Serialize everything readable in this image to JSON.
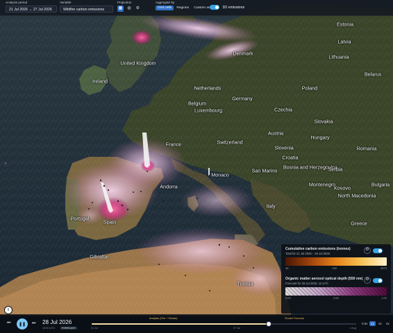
{
  "header": {
    "analysis_period_label": "Analysis period",
    "analysis_period_value": "21 Jul 2026 → 27 Jul 2026",
    "variable_label": "Variable",
    "variable_value": "Wildfire carbon emissions",
    "projection_label": "Projection",
    "projection_options": [
      "map-icon",
      "globe-icon"
    ],
    "aggregate_label": "Aggregate by",
    "aggregate_options": [
      "Grid cells",
      "Regions",
      "Custom areas"
    ],
    "aggregate_selected": "Grid cells",
    "emissions_3d_label": "3D emissions",
    "emissions_3d_enabled": true
  },
  "map": {
    "labels": [
      {
        "text": "Estonia",
        "name": "estonia"
      },
      {
        "text": "Latvia",
        "name": "latvia"
      },
      {
        "text": "Lithuania",
        "name": "lithuania"
      },
      {
        "text": "Denmark",
        "name": "denmark"
      },
      {
        "text": "United Kingdom",
        "name": "united-kingdom"
      },
      {
        "text": "Ireland",
        "name": "ireland"
      },
      {
        "text": "Belarus",
        "name": "belarus"
      },
      {
        "text": "Netherlands",
        "name": "netherlands"
      },
      {
        "text": "Poland",
        "name": "poland"
      },
      {
        "text": "Germany",
        "name": "germany"
      },
      {
        "text": "Belgium",
        "name": "belgium"
      },
      {
        "text": "Luxembourg",
        "name": "luxembourg"
      },
      {
        "text": "Czechia",
        "name": "czechia"
      },
      {
        "text": "Slovakia",
        "name": "slovakia"
      },
      {
        "text": "Austria",
        "name": "austria"
      },
      {
        "text": "Hungary",
        "name": "hungary"
      },
      {
        "text": "Switzerland",
        "name": "switzerland"
      },
      {
        "text": "France",
        "name": "france"
      },
      {
        "text": "Slovenia",
        "name": "slovenia"
      },
      {
        "text": "Croatia",
        "name": "croatia"
      },
      {
        "text": "Romania",
        "name": "romania"
      },
      {
        "text": "San Marino",
        "name": "san-marino"
      },
      {
        "text": "Bosnia and Herzegovina",
        "name": "bosnia"
      },
      {
        "text": "Serbia",
        "name": "serbia"
      },
      {
        "text": "Monaco",
        "name": "monaco"
      },
      {
        "text": "Andorra",
        "name": "andorra"
      },
      {
        "text": "Montenegro",
        "name": "montenegro"
      },
      {
        "text": "Bulgaria",
        "name": "bulgaria"
      },
      {
        "text": "Kosovo",
        "name": "kosovo"
      },
      {
        "text": "North Macedonia",
        "name": "north-macedonia"
      },
      {
        "text": "Portugal",
        "name": "portugal"
      },
      {
        "text": "Spain",
        "name": "spain"
      },
      {
        "text": "Italy",
        "name": "italy"
      },
      {
        "text": "Greece",
        "name": "greece"
      },
      {
        "text": "Gibraltar",
        "name": "gibraltar"
      },
      {
        "text": "Tunisia",
        "name": "tunisia"
      }
    ]
  },
  "legend": {
    "emissions_title": "Cumulative carbon emissions (tonnes)",
    "emissions_subtitle": "Total for 21 Jul 2026 – 26 Jul 2026",
    "emissions_ticks": [
      "46",
      "400",
      "4573"
    ],
    "emissions_colors": [
      "#4b1602",
      "#a0440c",
      "#e7821b",
      "#f6c255",
      "#fff3cf"
    ],
    "aod_title": "Organic matter aerosol optical depth (550 nm)",
    "aod_subtitle": "Forecast for 28 Jul 2026, 12 UTC",
    "aod_ticks": [
      "0.00",
      "0.50",
      "1.00"
    ],
    "aod_colors": [
      "#f2f2f2",
      "#d7b6de",
      "#9b3f8b",
      "#5a0b43"
    ]
  },
  "timeline": {
    "date": "28 Jul 2026",
    "time": "12:00 UTC",
    "badge": "FORECAST",
    "analysis_caption": "Analysis (Fire + Smoke)",
    "forecast_caption": "Smoke Forecast",
    "ticks": [
      "21 Jul",
      "27 Jul",
      "1 Aug"
    ],
    "progress": 0.67,
    "speeds": [
      "0.5x",
      "1x",
      "2x",
      "4x"
    ],
    "speed_selected": "1x"
  }
}
